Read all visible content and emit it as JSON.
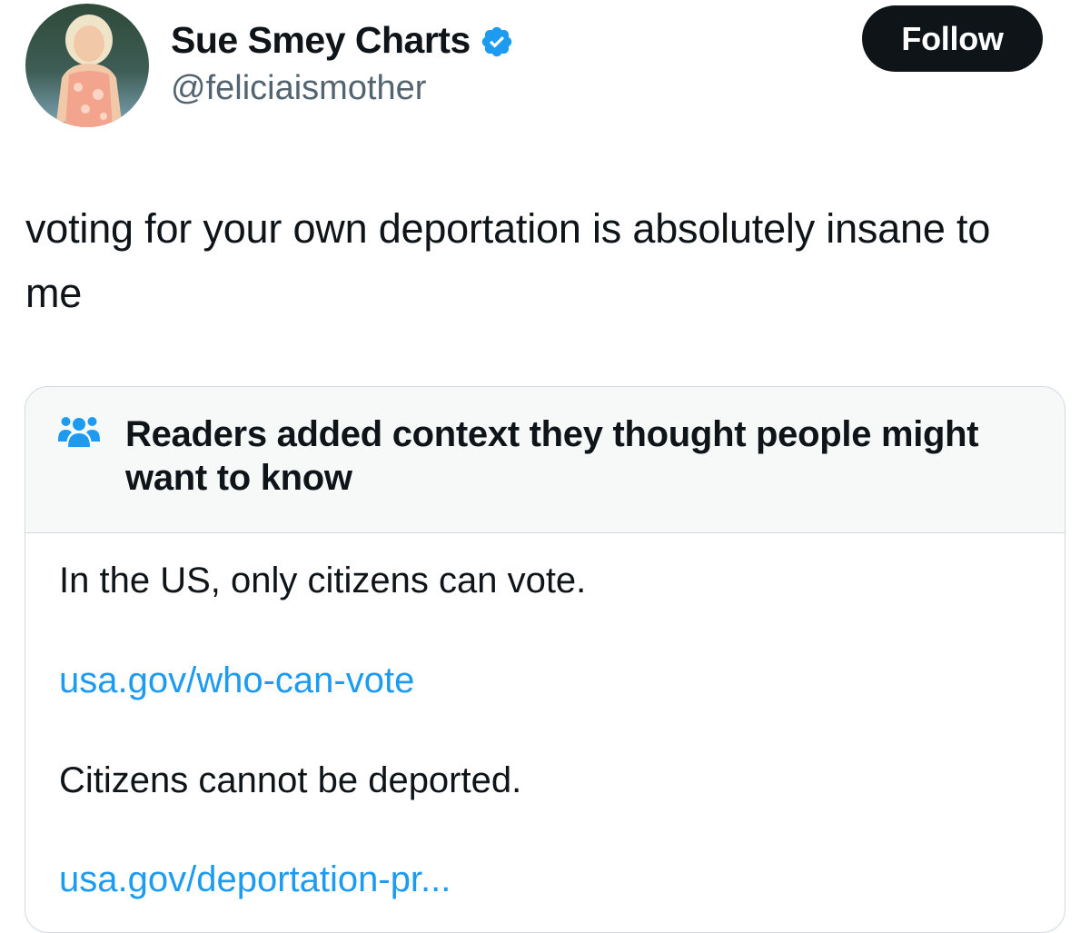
{
  "author": {
    "display_name": "Sue Smey Charts",
    "handle": "@feliciaismother",
    "verified_badge": "verified-icon"
  },
  "follow_button": {
    "label": "Follow"
  },
  "tweet": {
    "text": "voting for your own deportation is absolutely insane to me"
  },
  "community_note": {
    "header_icon": "people-icon",
    "title": "Readers added context they thought people might want to know",
    "lines": [
      {
        "kind": "text",
        "value": "In the US, only citizens can vote."
      },
      {
        "kind": "link",
        "value": "usa.gov/who-can-vote"
      },
      {
        "kind": "text",
        "value": "Citizens cannot be deported."
      },
      {
        "kind": "link",
        "value": "usa.gov/deportation-pr..."
      }
    ]
  },
  "colors": {
    "text": "#0f1419",
    "secondary_text": "#536471",
    "link": "#1d9bf0",
    "verified": "#1d9bf0",
    "follow_bg": "#0f1419",
    "note_header_bg": "#f7f9f9",
    "border": "#cfd9de"
  }
}
